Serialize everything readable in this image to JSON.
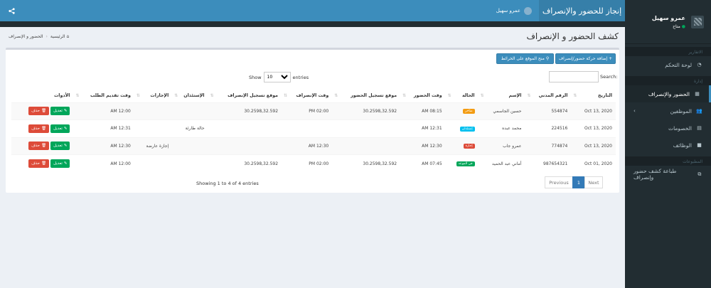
{
  "header": {
    "brand": "إنجاز للحضور والإنصراف",
    "user_name": "عمرو سهيل",
    "share_icon": "share-icon"
  },
  "sidebar": {
    "user_name": "عمرو سهيل",
    "user_status": "متاح",
    "section1": "الاتقارير",
    "section2": "إدارة",
    "section3": "المطبوعات",
    "items": [
      {
        "label": "لوحة التحكم",
        "icon": "dashboard-icon"
      },
      {
        "label": "الحضور والإنصراف",
        "icon": "calendar-icon"
      },
      {
        "label": "الموظفين",
        "icon": "users-icon"
      },
      {
        "label": "الخصومات",
        "icon": "file-icon"
      },
      {
        "label": "الوظائف",
        "icon": "briefcase-icon"
      },
      {
        "label": "طباعة كشف حضور وإنصراف",
        "icon": "copy-icon"
      }
    ]
  },
  "content": {
    "title": "كشف الحضور و الإنصراف",
    "breadcrumb": {
      "home": "الرئيسية",
      "current": "الحضور و الإنصراف"
    }
  },
  "box": {
    "add_button": "إضافة حركة حضور/إنصراف",
    "map_button": "منح الموقع على الخرائط",
    "search_label": "Search:",
    "search_placeholder": "",
    "show_label": "Show",
    "entries_label": "entries",
    "length_value": "10",
    "columns": [
      "التاريخ",
      "الرقم المدني",
      "الإسم",
      "الحالة",
      "وقت الحضور",
      "موقع تسجيل الحضور",
      "وقت الإنصراف",
      "موقع تسجيل الإنصراف",
      "الإستئذان",
      "الإجازات",
      "وقت تقديم الطلب",
      "الأدوات"
    ],
    "rows": [
      {
        "date": "Oct 13, 2020",
        "civil": "554874",
        "name": "حسين الجاسمي",
        "status": "متأخر",
        "status_color": "#f39c12",
        "in_time": "08:15 AM",
        "in_loc": "30.2598,32.592",
        "out_time": "02:00 PM",
        "out_loc": "30.2598,32.592",
        "permission": "",
        "leave": "",
        "req_time": "12:00 AM",
        "edit": "تعديل",
        "del": "حذف"
      },
      {
        "date": "Oct 13, 2020",
        "civil": "224516",
        "name": "محمد عبده",
        "status": "إستئذان",
        "status_color": "#00c0ef",
        "in_time": "12:31 AM",
        "in_loc": "",
        "out_time": "",
        "out_loc": "",
        "permission": "حالة طارئة",
        "leave": "",
        "req_time": "12:31 AM",
        "edit": "تعديل",
        "del": "حذف"
      },
      {
        "date": "Oct 13, 2020",
        "civil": "774874",
        "name": "عمرو جاب",
        "status": "إجازة",
        "status_color": "#dd4b39",
        "in_time": "12:30 AM",
        "in_loc": "",
        "out_time": "12:30 AM",
        "out_loc": "",
        "permission": "",
        "leave": "إجازة عارضة",
        "req_time": "12:30 AM",
        "edit": "تعديل",
        "del": "حذف"
      },
      {
        "date": "Oct 01, 2020",
        "civil": "987654321",
        "name": "أماني عبد الحميد",
        "status": "في الموعد",
        "status_color": "#00a65a",
        "in_time": "07:45 AM",
        "in_loc": "30.2598,32.592",
        "out_time": "02:00 PM",
        "out_loc": "30.2598,32.592",
        "permission": "",
        "leave": "",
        "req_time": "12:00 AM",
        "edit": "تعديل",
        "del": "حذف"
      }
    ],
    "info": "Showing 1 to 4 of 4 entries",
    "pager": {
      "prev": "Previous",
      "current": "1",
      "next": "Next"
    }
  }
}
